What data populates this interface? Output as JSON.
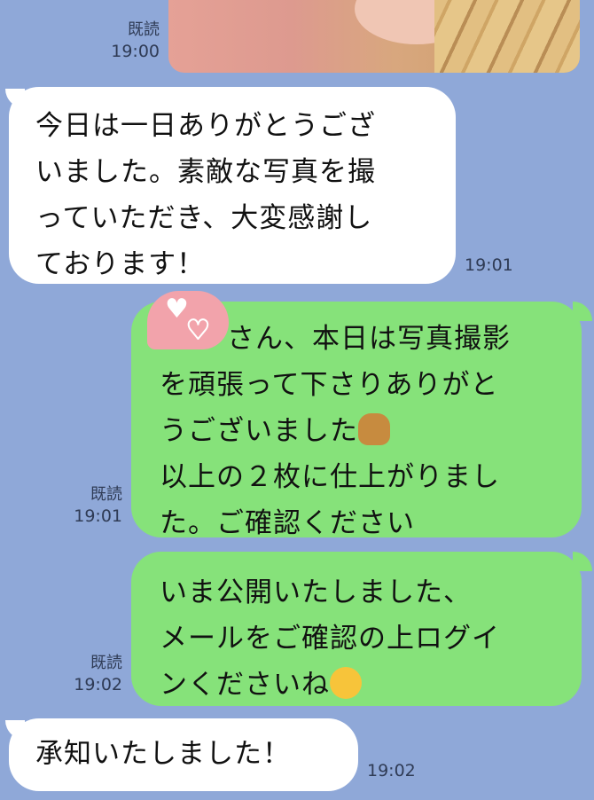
{
  "messages": [
    {
      "id": "m0",
      "meta_read": "既読",
      "meta_time": "19:00"
    },
    {
      "id": "m1",
      "text_lines": [
        "今日は一日ありがとうござ",
        "いました。素敵な写真を撮",
        "っていただき、大変感謝し",
        "ております！"
      ],
      "time": "19:01"
    },
    {
      "id": "m2",
      "text_lines": [
        "さん、本日は写真撮影",
        "を頑張って下さりありがと",
        "うございました",
        "以上の２枚に仕上がりまし",
        "た。ご確認ください"
      ],
      "meta_read": "既読",
      "meta_time": "19:01",
      "emoji": "person-bowing-icon"
    },
    {
      "id": "m3",
      "text_lines": [
        "いま公開いたしました、",
        "メールをご確認の上ログイ",
        "ンくださいね"
      ],
      "meta_read": "既読",
      "meta_time": "19:02",
      "emoji": "smiling-face-icon"
    },
    {
      "id": "m4",
      "text_lines": [
        "承知いたしました！"
      ],
      "time": "19:02"
    }
  ],
  "colors": {
    "background": "#8fa8d8",
    "sent_bubble": "#86e27a",
    "received_bubble": "#ffffff",
    "sticker": "#f2a3ab"
  }
}
